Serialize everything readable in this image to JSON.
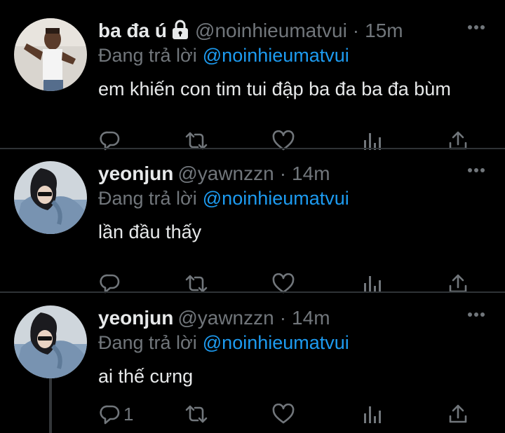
{
  "tweets": [
    {
      "name": "ba đa ú",
      "protected": true,
      "handle": "@noinhieumatvui",
      "time": "15m",
      "replying_label": "Đang trả lời",
      "replying_to": "@noinhieumatvui",
      "text": "em khiến con tim tui đập ba đa ba đa bùm",
      "reply_count": ""
    },
    {
      "name": "yeonjun",
      "protected": false,
      "handle": "@yawnzzn",
      "time": "14m",
      "replying_label": "Đang trả lời",
      "replying_to": "@noinhieumatvui",
      "text": "lần đầu thấy",
      "reply_count": ""
    },
    {
      "name": "yeonjun",
      "protected": false,
      "handle": "@yawnzzn",
      "time": "14m",
      "replying_label": "Đang trả lời",
      "replying_to": "@noinhieumatvui",
      "text": "ai thế cưng",
      "reply_count": "1"
    }
  ],
  "separator": "·",
  "colors": {
    "background": "#000000",
    "text": "#e7e9ea",
    "muted": "#71767b",
    "link": "#1d9bf0",
    "divider": "#2f3336"
  },
  "icons": [
    "reply-icon",
    "retweet-icon",
    "like-icon",
    "views-icon",
    "share-icon",
    "more-icon",
    "lock-icon"
  ]
}
